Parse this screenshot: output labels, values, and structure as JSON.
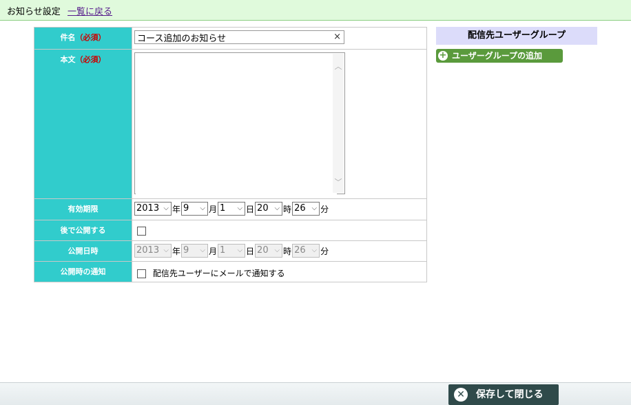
{
  "header": {
    "title": "お知らせ設定",
    "back_link": "一覧に戻る"
  },
  "form": {
    "subject": {
      "label": "件名",
      "required_mark": "（必須）",
      "value": "コース追加のお知らせ",
      "clear_icon": "×"
    },
    "body": {
      "label": "本文",
      "required_mark": "（必須）",
      "value": ""
    },
    "expiry": {
      "label": "有効期限",
      "year": "2013",
      "year_unit": "年",
      "month": "9",
      "month_unit": "月",
      "day": "1",
      "day_unit": "日",
      "hour": "20",
      "hour_unit": "時",
      "minute": "26",
      "minute_unit": "分"
    },
    "publish_later": {
      "label": "後で公開する",
      "checked": false
    },
    "publish_datetime": {
      "label": "公開日時",
      "year": "2013",
      "year_unit": "年",
      "month": "9",
      "month_unit": "月",
      "day": "1",
      "day_unit": "日",
      "hour": "20",
      "hour_unit": "時",
      "minute": "26",
      "minute_unit": "分",
      "disabled": true
    },
    "notify": {
      "label": "公開時の通知",
      "checkbox_text": "配信先ユーザーにメールで通知する",
      "checked": false
    }
  },
  "sidebar": {
    "heading": "配信先ユーザーグループ",
    "add_button": "ユーザーグループの追加"
  },
  "footer": {
    "save_close_label": "保存して閉じる"
  },
  "icons": {
    "clear": "close-icon",
    "dropdown": "chevron-down-icon",
    "add": "plus-circle-icon",
    "close": "close-circle-icon",
    "scroll_up": "chevron-up-icon",
    "scroll_down": "chevron-down-icon"
  },
  "colors": {
    "topbar_bg": "#e0fadc",
    "label_bg": "#31cccc",
    "required": "#cc0000",
    "sidebar_head_bg": "#dcdcfa",
    "add_button_bg": "#5a9a3c",
    "save_button_bg": "#2f4a4a",
    "back_link": "#551a8b"
  }
}
